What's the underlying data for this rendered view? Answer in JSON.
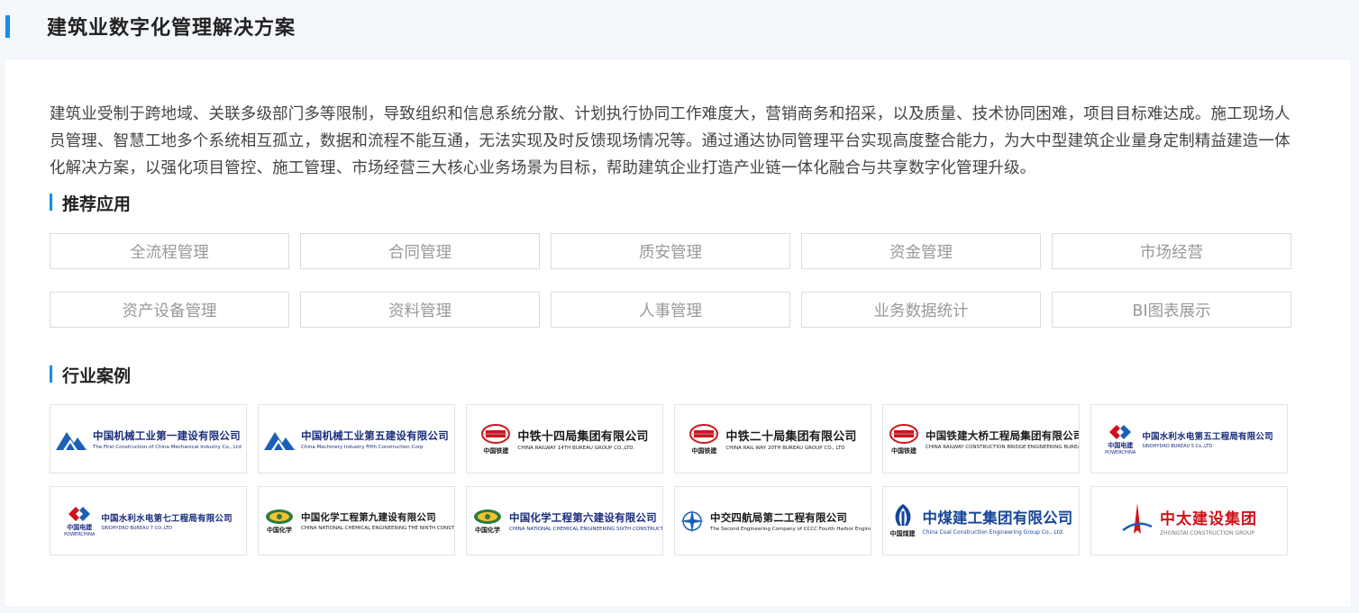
{
  "header": {
    "title": "建筑业数字化管理解决方案"
  },
  "intro": "建筑业受制于跨地域、关联多级部门多等限制，导致组织和信息系统分散、计划执行协同工作难度大，营销商务和招采，以及质量、技术协同困难，项目目标难达成。施工现场人员管理、智慧工地多个系统相互孤立，数据和流程不能互通，无法实现及时反馈现场情况等。通过通达协同管理平台实现高度整合能力，为大中型建筑企业量身定制精益建造一体化解决方案，以强化项目管控、施工管理、市场经营三大核心业务场景为目标，帮助建筑企业打造产业链一体化融合与共享数字化管理升级。",
  "sections": {
    "apps_title": "推荐应用",
    "cases_title": "行业案例"
  },
  "apps": [
    "全流程管理",
    "合同管理",
    "质安管理",
    "资金管理",
    "市场经营",
    "资产设备管理",
    "资料管理",
    "人事管理",
    "业务数据统计",
    "BI图表展示"
  ],
  "cases": [
    {
      "cn": "中国机械工业第一建设有限公司",
      "en": "The First Construction of China Mechanical Industry Co., Ltd",
      "mark": "mountain-logo-icon"
    },
    {
      "cn": "中国机械工业第五建设有限公司",
      "en": "China Machinery Industry Fifth Construction Corp",
      "mark": "mountain-logo-icon"
    },
    {
      "cn": "中铁十四局集团有限公司",
      "en": "CHINA RAILWAY 14TH BUREAU GROUP CO.,LTD.",
      "mark": "crcc-logo-icon",
      "sub": "中国铁建"
    },
    {
      "cn": "中铁二十局集团有限公司",
      "en": "CHINA RAIL WAY 20TH BUREAU GROUP CO., LTD",
      "mark": "crcc-logo-icon",
      "sub": "中国铁建"
    },
    {
      "cn": "中国铁建大桥工程局集团有限公司",
      "en": "CHINA RAILWAY CONSTRUCTION BRIDGE ENGINEERING BUREAU GROUP CO.,LTD.",
      "mark": "crcc-logo-icon",
      "sub": "中国铁建"
    },
    {
      "cn": "中国水利水电第五工程局有限公司",
      "en": "SINOHYDRO BUREAU 5 Co.,LTD",
      "mark": "powerchina-logo-icon",
      "sub": "中国电建",
      "sub_en": "POWERCHINA"
    },
    {
      "cn": "中国水利水电第七工程局有限公司",
      "en": "SINOHYDRO BUREAU 7 CO.,LTD",
      "mark": "powerchina-logo-icon",
      "sub": "中国电建",
      "sub_en": "POWERCHINA"
    },
    {
      "cn": "中国化学工程第九建设有限公司",
      "en": "CHINA NATIONAL CHEMICAL ENGINEERING THE NINTH CONSTRUCTION CO., LTD.",
      "mark": "cncec-logo-icon",
      "sub": "中国化学"
    },
    {
      "cn": "中国化学工程第六建设有限公司",
      "en": "CHINA NATIONAL CHEMICAL ENGINEERING SIXTH CONSTRUCTION CO., LTD.",
      "mark": "cncec-logo-icon",
      "sub": "中国化学"
    },
    {
      "cn": "中交四航局第二工程有限公司",
      "en": "The Second Engineering Company of CCCC Fourth Harbor Engineering Co., Ltd.",
      "mark": "cccc-logo-icon"
    },
    {
      "cn": "中煤建工集团有限公司",
      "en": "China Coal Construction Engineering Group Co., Ltd.",
      "mark": "coal-logo-icon",
      "sub": "中国煤建"
    },
    {
      "cn": "中太建设集团",
      "en": "ZHONGTAI CONSTRUCTION GROUP",
      "mark": "zhongtai-logo-icon"
    }
  ],
  "colors": {
    "accent": "#1a8be8",
    "brand_navy": "#1b2d7c",
    "brand_red": "#d0121b"
  }
}
